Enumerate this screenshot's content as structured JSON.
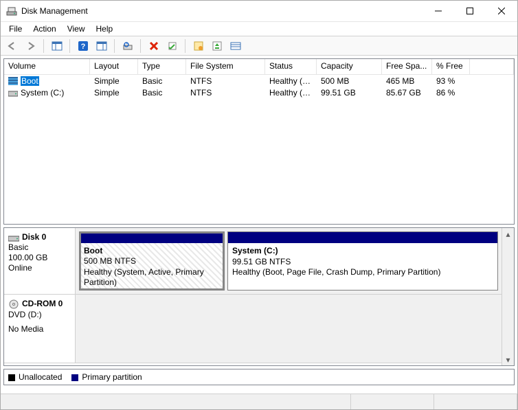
{
  "window": {
    "title": "Disk Management"
  },
  "menus": [
    "File",
    "Action",
    "View",
    "Help"
  ],
  "toolbar_icons": [
    "back-arrow-icon",
    "forward-arrow-icon",
    "|",
    "show-hide-console-tree-icon",
    "|",
    "help-icon",
    "show-hide-action-pane-icon",
    "|",
    "refresh-icon",
    "|",
    "delete-icon",
    "properties-icon",
    "|",
    "settings-icon",
    "eject-icon",
    "list-icon"
  ],
  "columns": [
    "Volume",
    "Layout",
    "Type",
    "File System",
    "Status",
    "Capacity",
    "Free Spa...",
    "% Free"
  ],
  "volumes": [
    {
      "name": "Boot",
      "icon": "volume-stripe-icon",
      "layout": "Simple",
      "type": "Basic",
      "fs": "NTFS",
      "status": "Healthy (S...",
      "capacity": "500 MB",
      "free": "465 MB",
      "pct": "93 %",
      "selected": true
    },
    {
      "name": "System (C:)",
      "icon": "volume-drive-icon",
      "layout": "Simple",
      "type": "Basic",
      "fs": "NTFS",
      "status": "Healthy (B...",
      "capacity": "99.51 GB",
      "free": "85.67 GB",
      "pct": "86 %",
      "selected": false
    }
  ],
  "disks": [
    {
      "label": "Disk 0",
      "kind": "Basic",
      "size": "100.00 GB",
      "state": "Online",
      "icon": "hdd-icon",
      "partitions": [
        {
          "name": "Boot",
          "line2": "500 MB NTFS",
          "line3": "Healthy (System, Active, Primary Partition)",
          "style": "boot"
        },
        {
          "name": "System  (C:)",
          "line2": "99.51 GB NTFS",
          "line3": "Healthy (Boot, Page File, Crash Dump, Primary Partition)",
          "style": "sys"
        }
      ]
    },
    {
      "label": "CD-ROM 0",
      "kind": "DVD (D:)",
      "size": "",
      "state": "No Media",
      "icon": "optical-icon",
      "partitions": []
    }
  ],
  "legend": {
    "unallocated": "Unallocated",
    "primary": "Primary partition"
  }
}
